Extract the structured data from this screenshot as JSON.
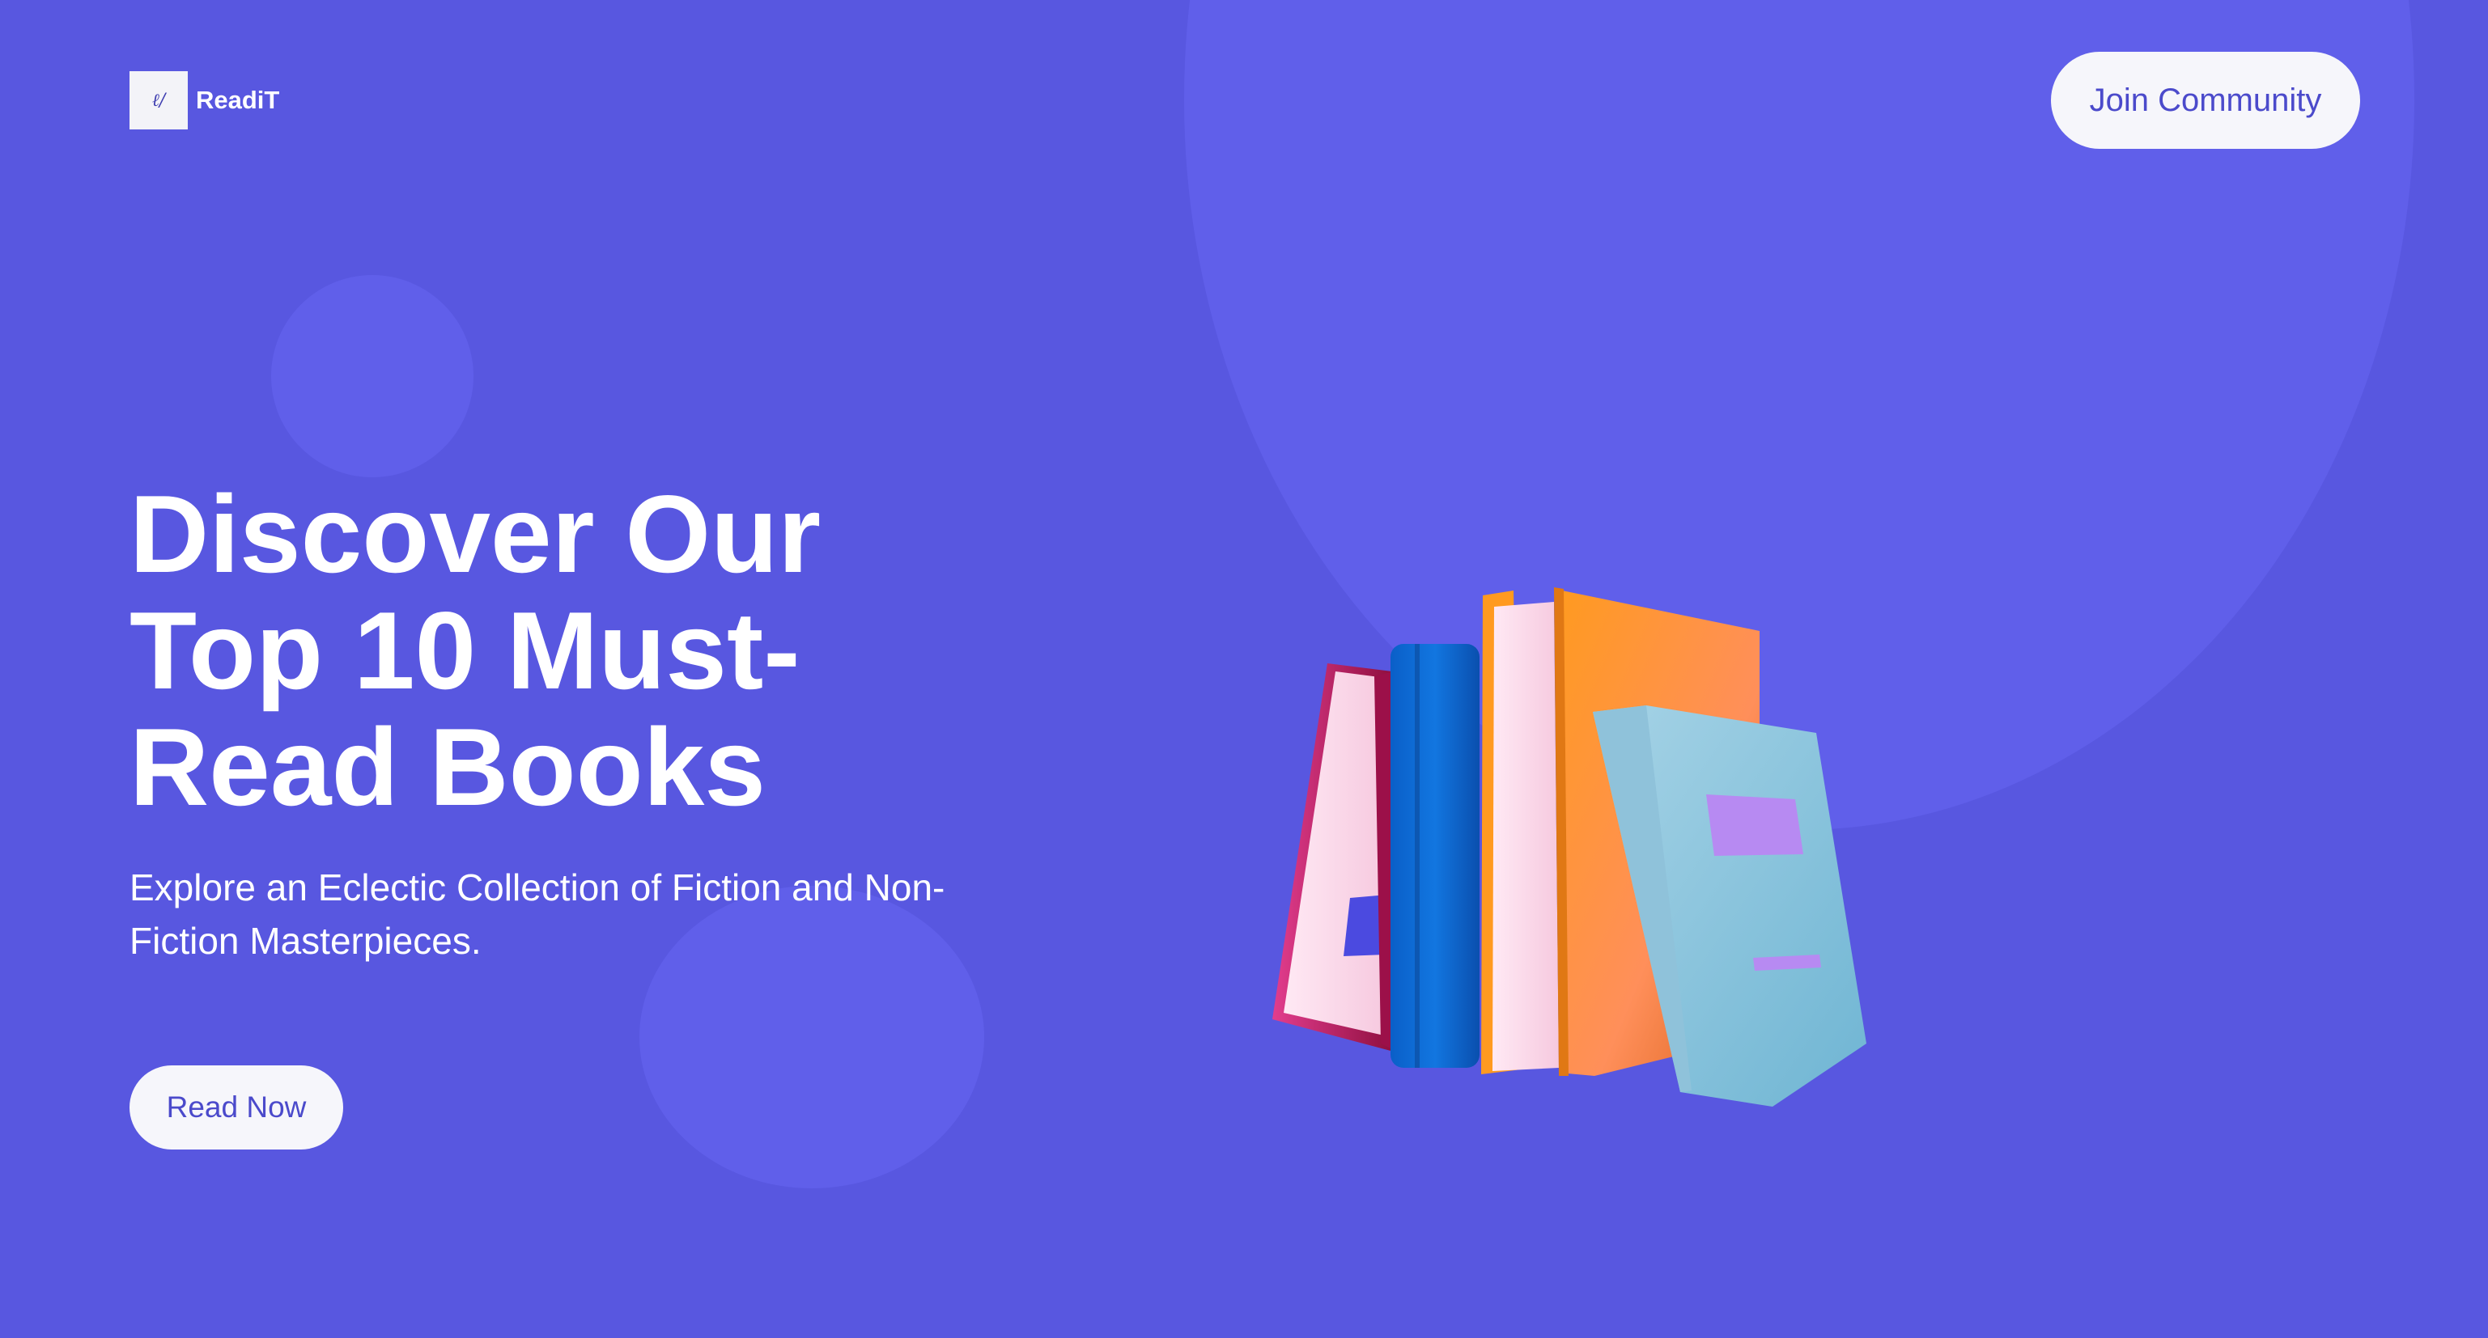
{
  "brand": {
    "name": "ReadiT",
    "logo_glyph": "ℓ/"
  },
  "header": {
    "join_label": "Join Community"
  },
  "hero": {
    "title": "Discover Our Top 10 Must-Read Books",
    "subtitle": "Explore an Eclectic Collection of Fiction and Non-Fiction Masterpieces.",
    "cta_label": "Read Now",
    "illustration": "stack-of-books-illustration"
  },
  "colors": {
    "background": "#5857E0",
    "circle": "#605FEA",
    "button_bg": "#F6F6FB",
    "button_text": "#4B4ACB"
  }
}
